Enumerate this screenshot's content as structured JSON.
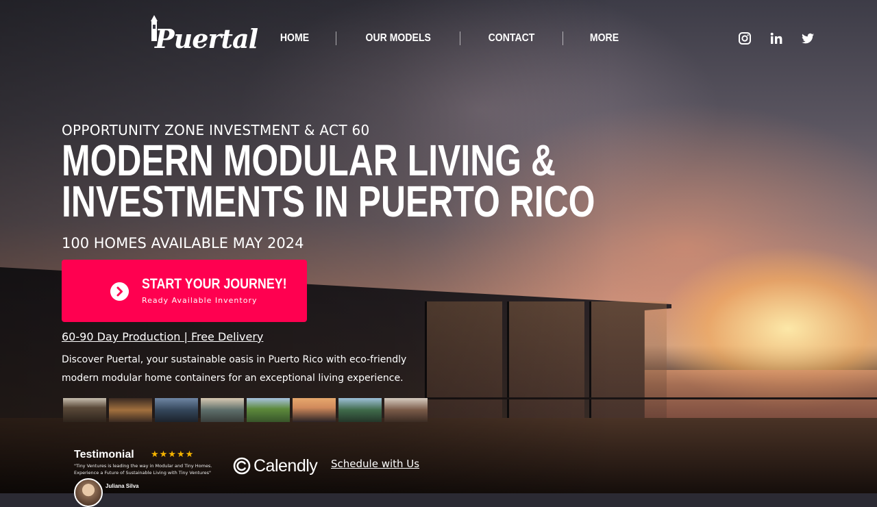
{
  "brand": {
    "logo_text": "Puertal"
  },
  "nav": {
    "items": [
      {
        "label": "HOME"
      },
      {
        "label": "OUR MODELS"
      },
      {
        "label": "CONTACT"
      },
      {
        "label": "MORE"
      }
    ]
  },
  "social": {
    "icons": [
      "instagram-icon",
      "linkedin-icon",
      "twitter-icon"
    ]
  },
  "hero": {
    "kicker": "OPPORTUNITY ZONE INVESTMENT & ACT 60",
    "headline_line1": "MODERN MODULAR LIVING &",
    "headline_line2": "INVESTMENTS IN PUERTO RICO",
    "subhead": "100 HOMES AVAILABLE MAY 2024",
    "cta": {
      "title": "START YOUR JOURNEY!",
      "subtitle": "Ready Available Inventory",
      "icon": "chevron-right-circle-icon",
      "color": "#ff0050"
    },
    "production_link": "60-90 Day Production | Free Delivery",
    "description": "Discover Puertal, your sustainable oasis in Puerto Rico with eco-friendly modern modular home containers for an exceptional living experience."
  },
  "thumbnails": {
    "count_label": "8 gallery thumbnails",
    "colors": [
      "#5b4a3a",
      "#6a4a32",
      "#34465a",
      "#5d6e6a",
      "#5d8a3c",
      "#d08a5c",
      "#3f6a4a",
      "#7a5a48"
    ]
  },
  "testimonial": {
    "title": "Testimonial",
    "stars": "★★★★★",
    "quote": "\"Tiny Ventures is leading the way in Modular and Tiny Homes. Experience a Future of Sustainable Living with Tiny Ventures\"",
    "name": "Juliana Silva"
  },
  "calendly": {
    "wordmark": "Calendly"
  },
  "schedule_link": "Schedule with Us"
}
